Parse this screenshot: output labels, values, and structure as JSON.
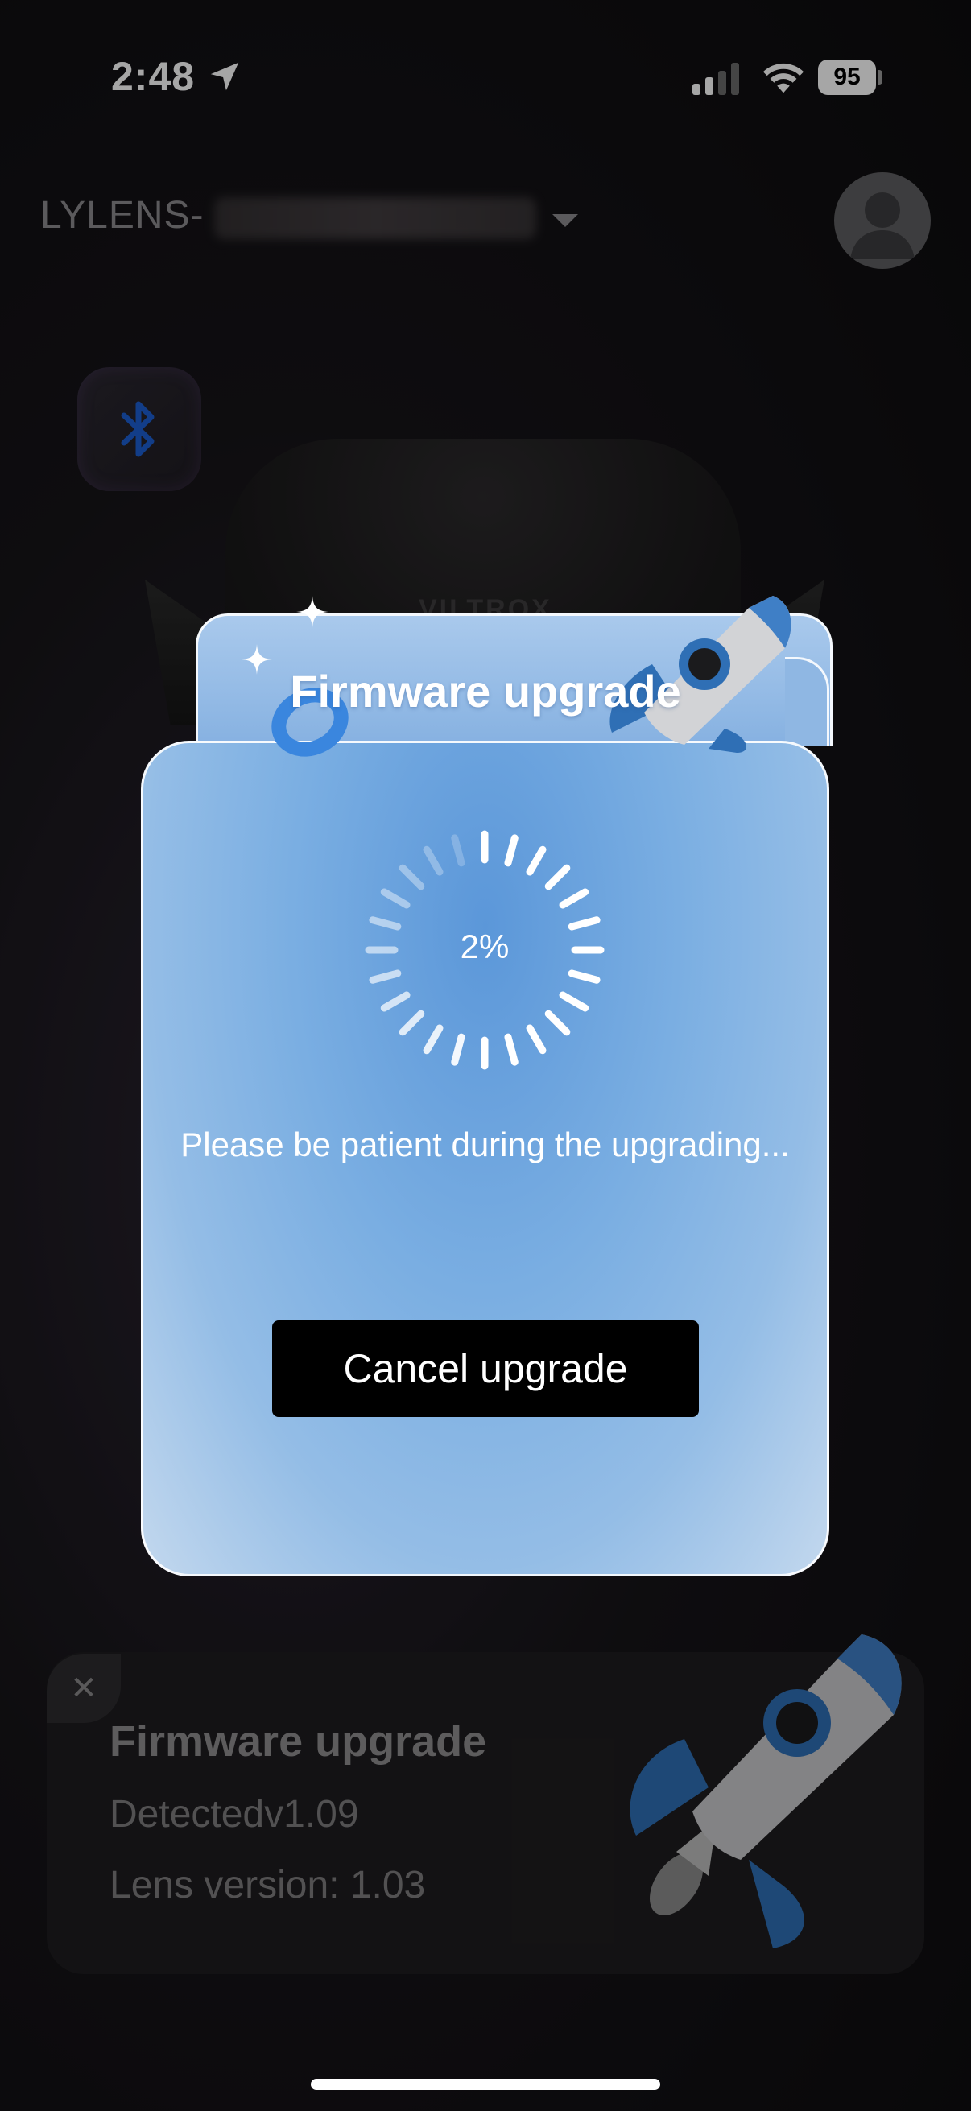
{
  "status_bar": {
    "time": "2:48",
    "battery": "95",
    "icons": [
      "location-arrow-icon",
      "cellular-signal-icon",
      "wifi-icon",
      "battery-icon"
    ]
  },
  "header": {
    "device_name_prefix": "LYLENS-",
    "dropdown_icon": "caret-down-icon",
    "avatar_icon": "user-avatar-icon"
  },
  "bluetooth": {
    "icon": "bluetooth-icon",
    "color": "#1d5fd1"
  },
  "background": {
    "brand_text": "VILTROX"
  },
  "modal": {
    "title": "Firmware upgrade",
    "progress_percent": 2,
    "progress_text": "2%",
    "message": "Please be patient during the upgrading...",
    "cancel_label": "Cancel upgrade",
    "accent": "#6aa3de"
  },
  "info_card": {
    "close_icon": "close-icon",
    "title": "Firmware upgrade",
    "detected": "Detectedv1.09",
    "lens_version": "Lens version: 1.03"
  }
}
